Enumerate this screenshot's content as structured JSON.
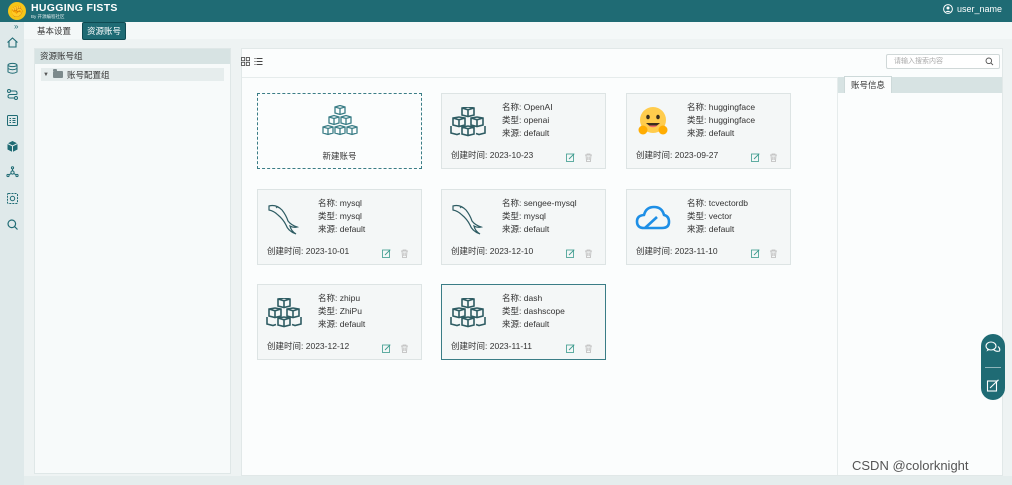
{
  "app": {
    "title": "HUGGING FISTS",
    "subtitle": "By 开源编程社区",
    "user": "user_name"
  },
  "tabs": [
    {
      "label": "基本设置",
      "active": false
    },
    {
      "label": "资源账号",
      "active": true
    }
  ],
  "sidebar": {
    "header": "资源账号组",
    "tree": [
      {
        "label": "账号配置组",
        "expanded": true
      }
    ]
  },
  "toolbar": {
    "search_placeholder": "请输入搜索内容",
    "views": [
      "grid-view-icon",
      "list-view-icon"
    ]
  },
  "new_card": {
    "label": "新建账号"
  },
  "labels": {
    "name": "名称:",
    "type": "类型:",
    "source": "来源:",
    "created": "创建时间:"
  },
  "cards": [
    {
      "name": "OpenAI",
      "type": "openai",
      "source": "default",
      "created": "2023-10-23",
      "icon": "cubes-icon"
    },
    {
      "name": "huggingface",
      "type": "huggingface",
      "source": "default",
      "created": "2023-09-27",
      "icon": "hugging-face-icon"
    },
    {
      "name": "mysql",
      "type": "mysql",
      "source": "default",
      "created": "2023-10-01",
      "icon": "mysql-dolphin-icon"
    },
    {
      "name": "sengee-mysql",
      "type": "mysql",
      "source": "default",
      "created": "2023-12-10",
      "icon": "mysql-dolphin-icon"
    },
    {
      "name": "tcvectordb",
      "type": "vector",
      "source": "default",
      "created": "2023-11-10",
      "icon": "cloud-icon"
    },
    {
      "name": "zhipu",
      "type": "ZhiPu",
      "source": "default",
      "created": "2023-12-12",
      "icon": "cubes-icon"
    },
    {
      "name": "dash",
      "type": "dashscope",
      "source": "default",
      "created": "2023-11-11",
      "icon": "cubes-icon"
    }
  ],
  "right_panel": {
    "tab": "账号信息"
  },
  "watermark": "CSDN @colorknight",
  "colors": {
    "brand": "#1f6b74",
    "accent_light": "#d7e3e3",
    "cloud": "#1e8fe6",
    "emoji": "#ffcc4d"
  }
}
